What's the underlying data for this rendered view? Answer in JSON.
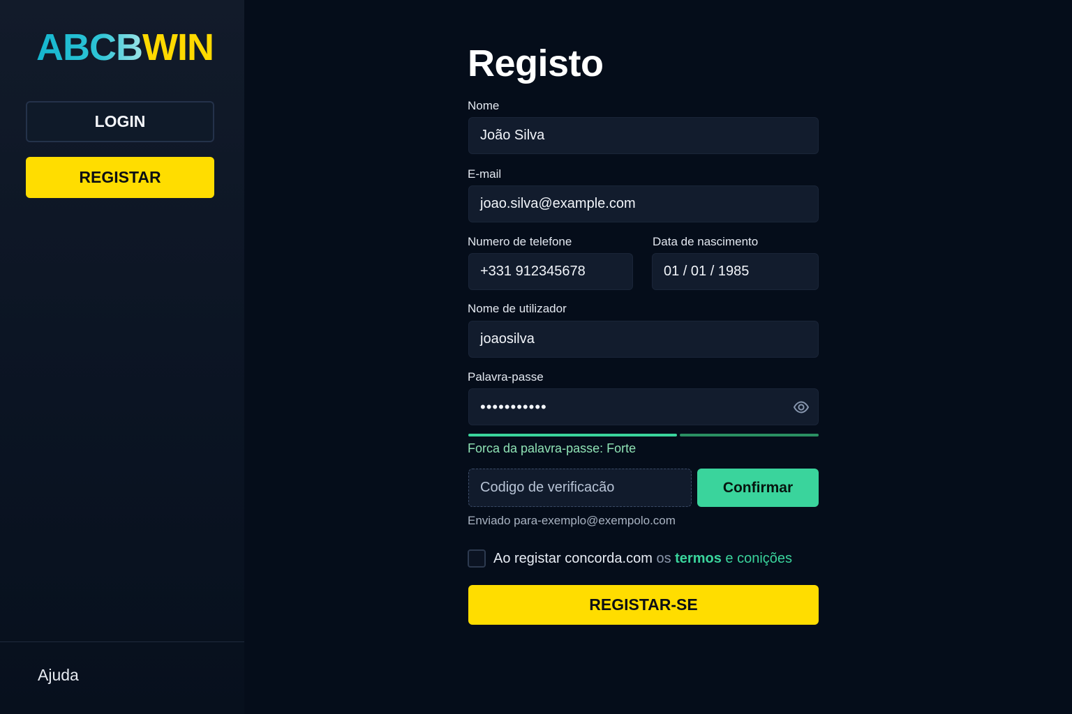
{
  "sidebar": {
    "logo_part1": "ABCB",
    "logo_part2": "WIN",
    "login_label": "LOGIN",
    "register_label": "REGISTAR",
    "help_label": "Ajuda"
  },
  "form": {
    "title": "Registo",
    "name": {
      "label": "Nome",
      "value": "João Silva"
    },
    "email": {
      "label": "E-mail",
      "value": "joao.silva@example.com"
    },
    "phone": {
      "label": "Numero de telefone",
      "value": "+331 912345678"
    },
    "birthdate": {
      "label": "Data de nascimento",
      "value": "01 /  01 / 1985"
    },
    "username": {
      "label": "Nome de utilizador",
      "value": "joaosilva"
    },
    "password": {
      "label": "Palavra-passe",
      "value": "•••••••••••",
      "icon": "eye-icon"
    },
    "strength": {
      "text": "Forca da palavra-passe: Forte",
      "level": 0.6
    },
    "verification": {
      "placeholder": "Codigo de verificacão",
      "confirm_label": "Confirmar",
      "sent_text": "Enviado para-exemplo@exempolo.com"
    },
    "terms": {
      "prefix": "Ao registar concorda.com",
      "os": "os",
      "termos": "termos",
      "rest": "e conições"
    },
    "submit_label": "REGISTAR-SE"
  },
  "colors": {
    "accent_yellow": "#ffdd00",
    "accent_green": "#3ad49c",
    "background": "#050d1a"
  }
}
